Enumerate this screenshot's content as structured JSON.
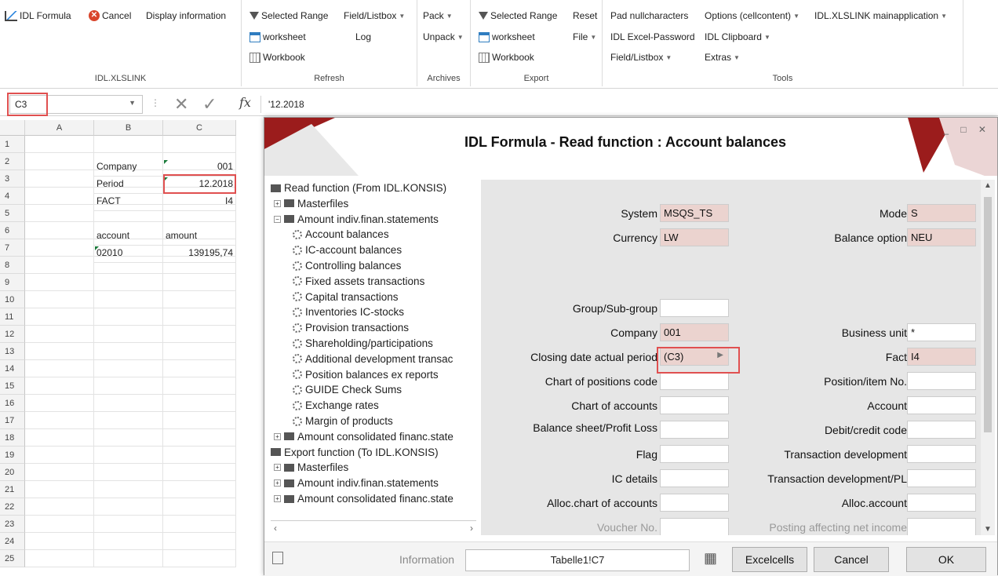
{
  "ribbon": {
    "idlxlslink": {
      "formula": "IDL Formula",
      "cancel": "Cancel",
      "display": "Display information",
      "label": "IDL.XLSLINK"
    },
    "refresh": {
      "selected_range": "Selected Range",
      "field_listbox": "Field/Listbox",
      "worksheet": "worksheet",
      "log": "Log",
      "workbook": "Workbook",
      "label": "Refresh"
    },
    "archives": {
      "pack": "Pack",
      "unpack": "Unpack",
      "label": "Archives"
    },
    "export": {
      "selected_range": "Selected Range",
      "reset": "Reset",
      "worksheet": "worksheet",
      "file": "File",
      "workbook": "Workbook",
      "label": "Export"
    },
    "tools": {
      "pad": "Pad nullcharacters",
      "options": "Options (cellcontent)",
      "mainapp": "IDL.XLSLINK mainapplication",
      "password": "IDL Excel-Password",
      "clipboard": "IDL Clipboard",
      "field_listbox": "Field/Listbox",
      "extras": "Extras",
      "label": "Tools"
    }
  },
  "formula_bar": {
    "name_box": "C3",
    "value": "'12.2018"
  },
  "sheet": {
    "columns": [
      "A",
      "B",
      "C"
    ],
    "rows": [
      "1",
      "2",
      "3",
      "4",
      "5",
      "6",
      "7",
      "8",
      "9",
      "10",
      "11",
      "12",
      "13",
      "14",
      "15",
      "16",
      "17",
      "18",
      "19",
      "20",
      "21",
      "22",
      "23",
      "24",
      "25"
    ],
    "cells": {
      "b2": "Company",
      "c2": "001",
      "b3": "Period",
      "c3": "12.2018",
      "b4": "FACT",
      "c4": "I4",
      "b6": "account",
      "c6": "amount",
      "b7": "02010",
      "c7": "139195,74"
    }
  },
  "dialog": {
    "title": "IDL Formula - Read function : Account balances",
    "tree": [
      "Read function (From IDL.KONSIS)",
      "Masterfiles",
      "Amount indiv.finan.statements",
      "Account balances",
      "IC-account balances",
      "Controlling balances",
      "Fixed assets transactions",
      "Capital transactions",
      "Inventories IC-stocks",
      "Provision transactions",
      "Shareholding/participations",
      "Additional development transac",
      "Position balances ex reports",
      "GUIDE Check Sums",
      "Exchange rates",
      "Margin of products",
      "Amount consolidated financ.state",
      "Export function (To IDL.KONSIS)",
      "Masterfiles",
      "Amount indiv.finan.statements",
      "Amount consolidated financ.state"
    ],
    "form": {
      "system_label": "System",
      "system_value": "MSQS_TS",
      "mode_label": "Mode",
      "mode_value": "S",
      "currency_label": "Currency",
      "currency_value": "LW",
      "balance_option_label": "Balance option",
      "balance_option_value": "NEU",
      "group_label": "Group/Sub-group",
      "company_label": "Company",
      "company_value": "001",
      "business_unit_label": "Business unit",
      "business_unit_value": "*",
      "closing_label": "Closing date actual period",
      "closing_value": "(C3)",
      "fact_label": "Fact",
      "fact_value": "I4",
      "chart_positions_label": "Chart of positions code",
      "position_item_label": "Position/item No.",
      "chart_accounts_label": "Chart of accounts",
      "account_label": "Account",
      "balance_sheet_label": "Balance sheet/Profit  Loss",
      "debit_credit_label": "Debit/credit code",
      "flag_label": "Flag",
      "transaction_dev_label": "Transaction development",
      "ic_details_label": "IC details",
      "transaction_dev_pl_label": "Transaction development/PL",
      "alloc_chart_label": "Alloc.chart of accounts",
      "alloc_account_label": "Alloc.account",
      "voucher_label": "Voucher No.",
      "posting_label": "Posting affecting net income"
    },
    "footer": {
      "information_label": "Information",
      "information_value": "Tabelle1!C7",
      "excelcells": "Excelcells",
      "cancel": "Cancel",
      "ok": "OK"
    }
  }
}
